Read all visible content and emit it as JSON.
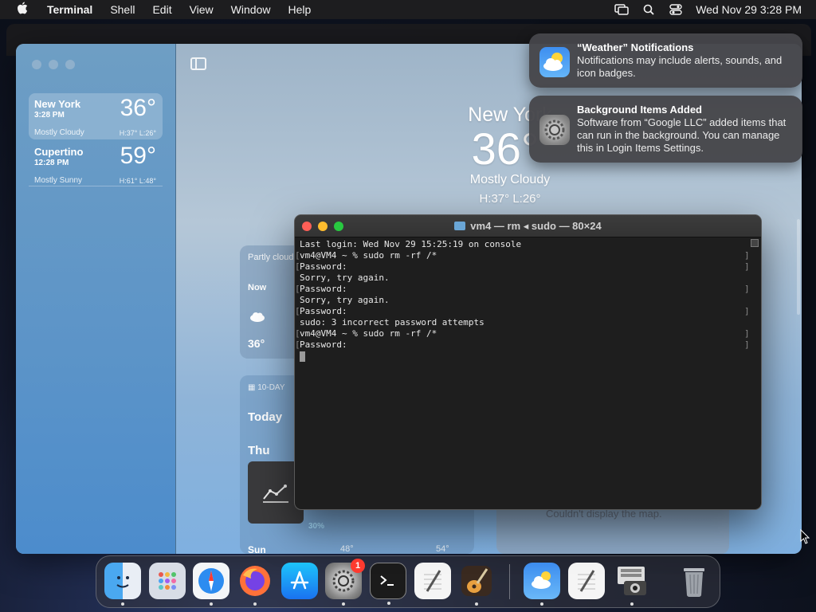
{
  "menubar": {
    "app_name": "Terminal",
    "items": [
      "Shell",
      "Edit",
      "View",
      "Window",
      "Help"
    ],
    "clock": "Wed Nov 29  3:28 PM"
  },
  "weather": {
    "cities": [
      {
        "name": "New York",
        "time": "3:28 PM",
        "temp": "36°",
        "condition": "Mostly Cloudy",
        "hl": "H:37°  L:26°"
      },
      {
        "name": "Cupertino",
        "time": "12:28 PM",
        "temp": "59°",
        "condition": "Mostly Sunny",
        "hl": "H:61°  L:48°"
      }
    ],
    "main": {
      "name": "New York",
      "temp": "36°",
      "condition": "Mostly Cloudy",
      "hl": "H:37°  L:26°"
    },
    "hourly": {
      "title": "Partly cloud",
      "now": "Now",
      "temp": "36°"
    },
    "tenday": {
      "header": "10-DAY",
      "today": "Today",
      "thu": "Thu",
      "sun": "Sun",
      "pct": "30%",
      "low": "48°",
      "high": "54°"
    },
    "map_message": "Couldn't display the map."
  },
  "terminal": {
    "title": "vm4 — rm ◂ sudo — 80×24",
    "lines": [
      "Last login: Wed Nov 29 15:25:19 on console",
      "vm4@VM4 ~ % sudo rm -rf /*",
      "Password:",
      "Sorry, try again.",
      "Password:",
      "Sorry, try again.",
      "Password:",
      "sudo: 3 incorrect password attempts",
      "vm4@VM4 ~ % sudo rm -rf /*",
      "Password:"
    ]
  },
  "notifications": [
    {
      "title": "“Weather” Notifications",
      "body": "Notifications may include alerts, sounds, and icon badges."
    },
    {
      "title": "Background Items Added",
      "body": "Software from “Google LLC” added items that can run in the background. You can manage this in Login Items Settings."
    }
  ],
  "dock": {
    "settings_badge": "1",
    "items": [
      "finder-icon",
      "launchpad-icon",
      "safari-icon",
      "firefox-icon",
      "app-store-icon",
      "system-settings-icon",
      "terminal-icon",
      "textedit-icon",
      "garageband-icon",
      "weather-icon",
      "textedit-icon",
      "image-capture-icon",
      "trash-icon"
    ]
  }
}
